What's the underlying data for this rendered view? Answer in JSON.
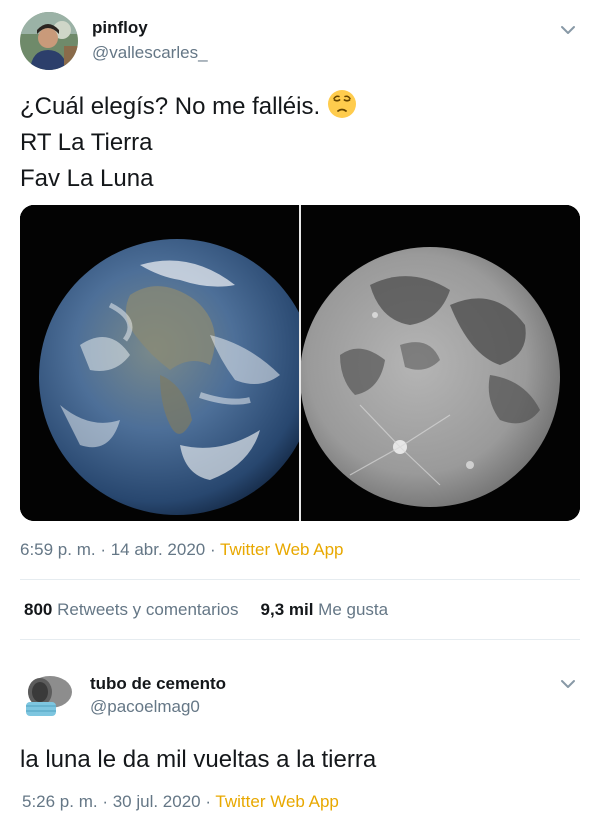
{
  "tweet": {
    "author_name": "pinfloy",
    "author_handle": "@vallescarles_",
    "lines": [
      "¿Cuál elegís? No me falléis.",
      "RT La Tierra",
      "Fav La Luna"
    ],
    "emoji": "pensive-face",
    "media": [
      "earth-image",
      "moon-image"
    ],
    "timestamp": "6:59 p. m. · 14 abr. 2020 · ",
    "source": "Twitter Web App",
    "retweets_count": "800",
    "retweets_label": " Retweets y comentarios",
    "likes_count": "9,3 mil",
    "likes_label": " Me gusta"
  },
  "reply": {
    "author_name": "tubo de cemento",
    "author_handle": "@pacoelmag0",
    "text": "la luna le da mil vueltas a la tierra",
    "timestamp": "5:26 p. m. · 30 jul. 2020 · ",
    "source": "Twitter Web App"
  },
  "colors": {
    "text": "#14171a",
    "muted": "#657786",
    "source_link": "#e8a800",
    "separator": "#e6ecf0"
  },
  "icons": [
    "chevron-down-icon",
    "pensive-face-emoji"
  ]
}
